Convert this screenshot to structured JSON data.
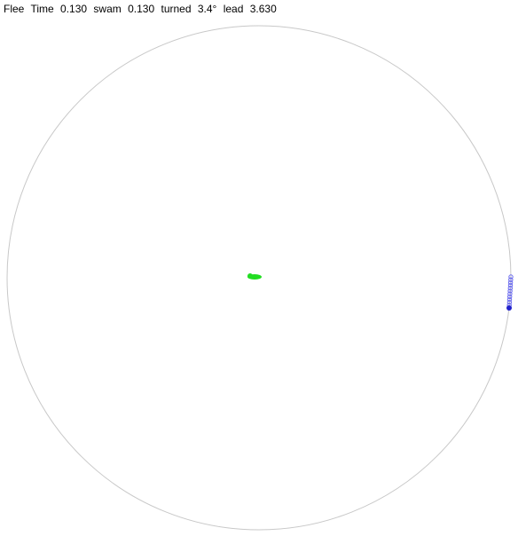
{
  "status": {
    "mode": "Flee",
    "time_label": "Time",
    "time_value": "0.130",
    "swam_label": "swam",
    "swam_value": "0.130",
    "turned_label": "turned",
    "turned_value": "3.4°",
    "lead_label": "lead",
    "lead_value": "3.630"
  },
  "colors": {
    "arena_border": "#c8c8c8",
    "fleeing_agent": "#22dd22",
    "pursuer_agent": "#2222cc",
    "pursuer_trail": "#6a6aee"
  },
  "agents": {
    "fleeing": {
      "name": "fleeing-agent"
    },
    "pursuer": {
      "name": "pursuer-agent"
    }
  }
}
